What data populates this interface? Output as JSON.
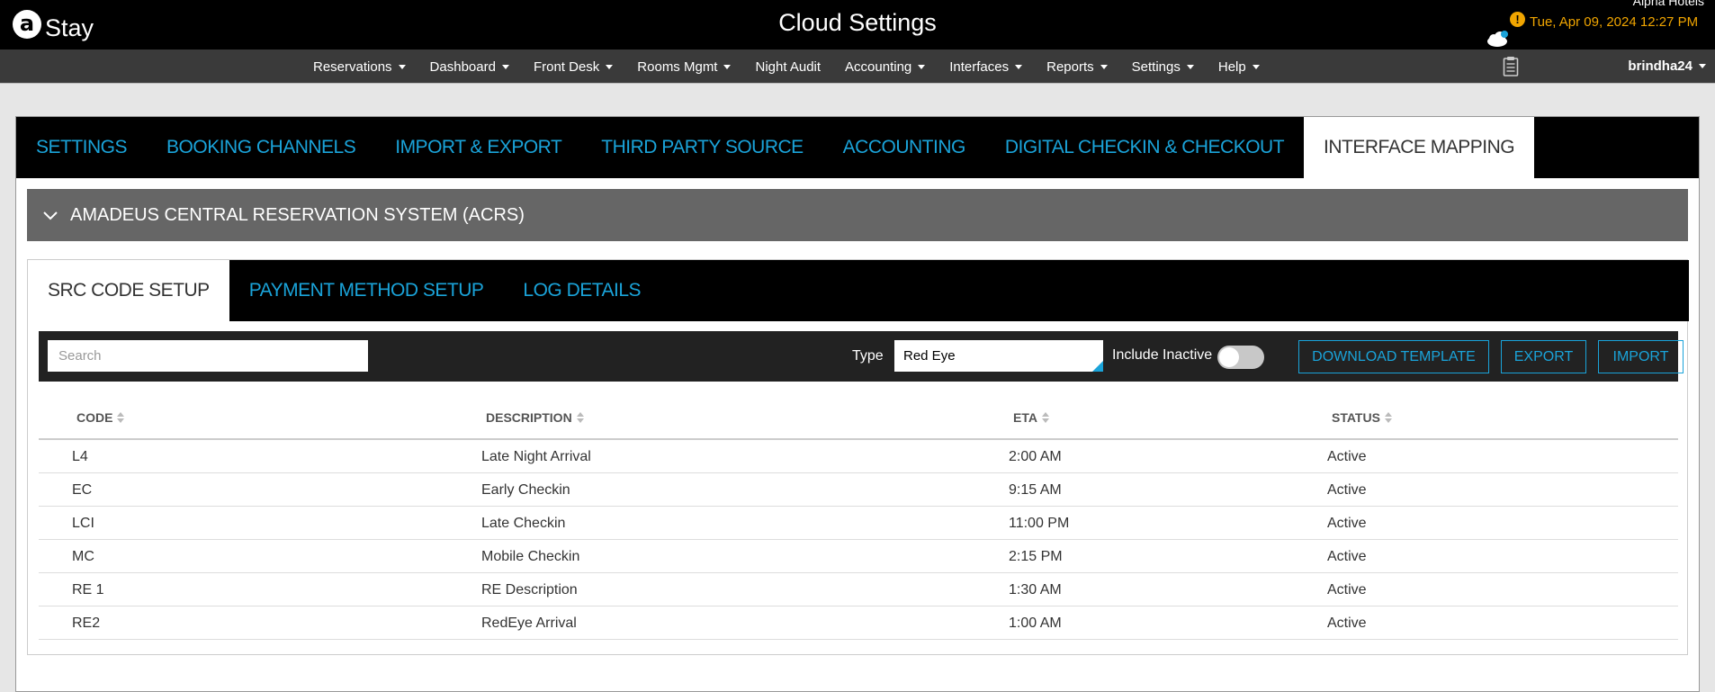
{
  "header": {
    "logo_letter": "a",
    "logo_text": "Stay",
    "title": "Cloud Settings",
    "hotel": "Alpha Hotels",
    "datetime": "Tue, Apr 09, 2024 12:27 PM",
    "alert_symbol": "!"
  },
  "nav": {
    "items": [
      {
        "label": "Reservations",
        "dropdown": true
      },
      {
        "label": "Dashboard",
        "dropdown": true
      },
      {
        "label": "Front Desk",
        "dropdown": true
      },
      {
        "label": "Rooms Mgmt",
        "dropdown": true
      },
      {
        "label": "Night Audit",
        "dropdown": false
      },
      {
        "label": "Accounting",
        "dropdown": true
      },
      {
        "label": "Interfaces",
        "dropdown": true
      },
      {
        "label": "Reports",
        "dropdown": true
      },
      {
        "label": "Settings",
        "dropdown": true
      },
      {
        "label": "Help",
        "dropdown": true
      }
    ],
    "user": "brindha24"
  },
  "tabs": [
    {
      "label": "SETTINGS",
      "active": false
    },
    {
      "label": "BOOKING CHANNELS",
      "active": false
    },
    {
      "label": "IMPORT & EXPORT",
      "active": false
    },
    {
      "label": "THIRD PARTY SOURCE",
      "active": false
    },
    {
      "label": "ACCOUNTING",
      "active": false
    },
    {
      "label": "DIGITAL CHECKIN & CHECKOUT",
      "active": false
    },
    {
      "label": "INTERFACE MAPPING",
      "active": true
    }
  ],
  "accordion": {
    "title": "AMADEUS CENTRAL RESERVATION SYSTEM (ACRS)"
  },
  "sub_tabs": [
    {
      "label": "SRC CODE SETUP",
      "active": true
    },
    {
      "label": "PAYMENT METHOD SETUP",
      "active": false
    },
    {
      "label": "LOG DETAILS",
      "active": false
    }
  ],
  "toolbar": {
    "search_placeholder": "Search",
    "type_label": "Type",
    "type_value": "Red Eye",
    "include_inactive_label": "Include Inactive",
    "include_inactive": false,
    "download_label": "DOWNLOAD TEMPLATE",
    "export_label": "EXPORT",
    "import_label": "IMPORT"
  },
  "table": {
    "columns": [
      "CODE",
      "DESCRIPTION",
      "ETA",
      "STATUS"
    ],
    "rows": [
      {
        "code": "L4",
        "description": "Late Night Arrival",
        "eta": "2:00 AM",
        "status": "Active"
      },
      {
        "code": "EC",
        "description": "Early Checkin",
        "eta": "9:15 AM",
        "status": "Active"
      },
      {
        "code": "LCI",
        "description": "Late Checkin",
        "eta": "11:00 PM",
        "status": "Active"
      },
      {
        "code": "MC",
        "description": "Mobile Checkin",
        "eta": "2:15 PM",
        "status": "Active"
      },
      {
        "code": "RE 1",
        "description": "RE Description",
        "eta": "1:30 AM",
        "status": "Active"
      },
      {
        "code": "RE2",
        "description": "RedEye Arrival",
        "eta": "1:00 AM",
        "status": "Active"
      }
    ]
  },
  "colors": {
    "accent": "#1aa3d9",
    "alert": "#f0a500",
    "header_bg": "#000000",
    "nav_bg": "#3a3a3a",
    "accordion_bg": "#666666"
  }
}
